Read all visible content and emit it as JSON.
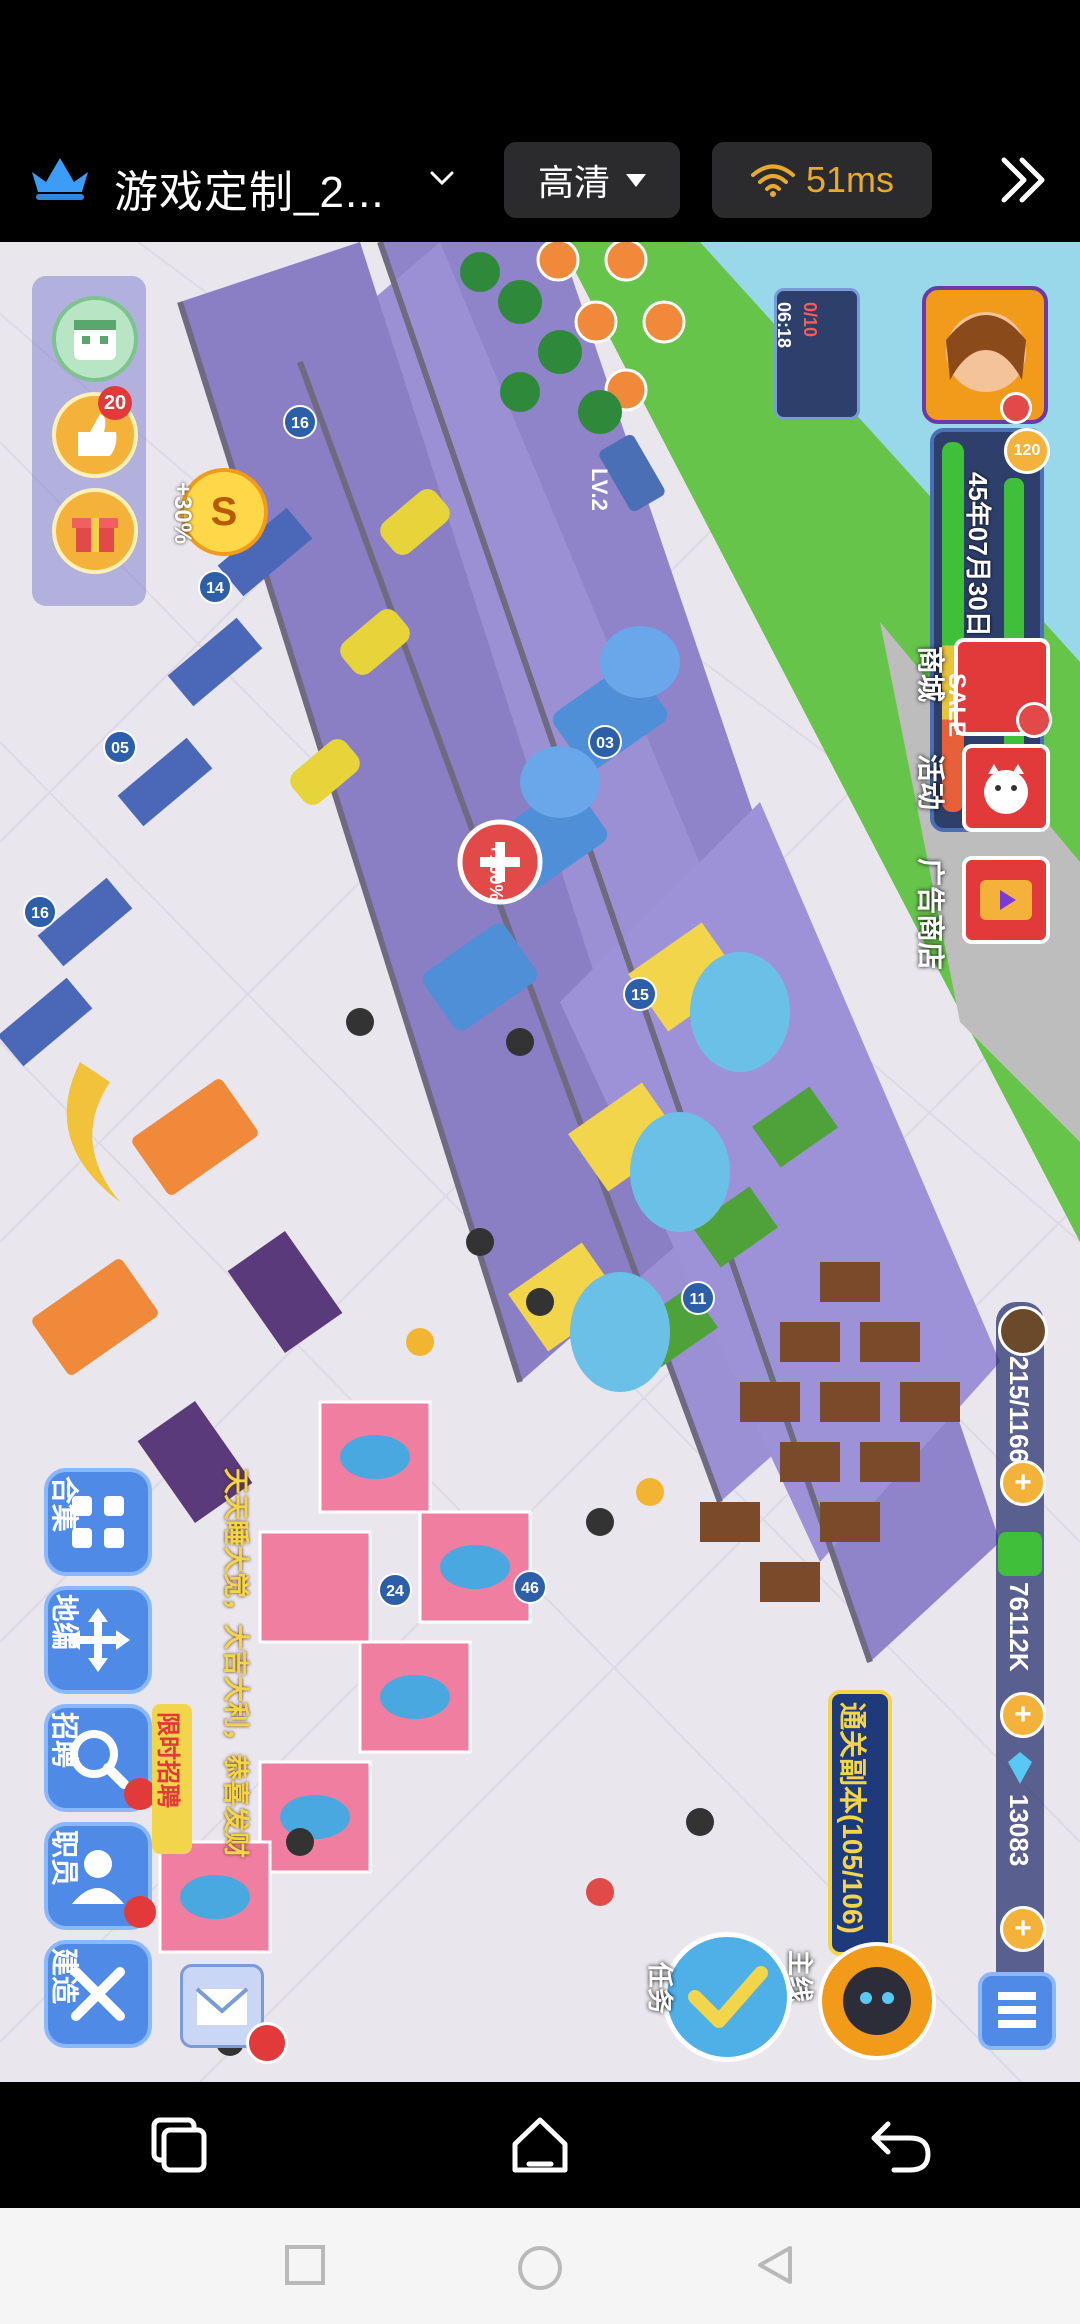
{
  "stream_bar": {
    "title": "游戏定制_2...",
    "quality_label": "高清",
    "ping": "51ms"
  },
  "hud": {
    "badge_count": "20",
    "bonus_percent": "+30%",
    "player_level": "120",
    "game_date": "45年07月30日",
    "timer_count": "0/10",
    "timer_time": "06:18",
    "level_tag": "LV.2",
    "shop_label": "商城",
    "sale_label": "SALE",
    "event_label": "活动",
    "ad_shop_label": "广告商店",
    "population": "215/1166",
    "money": "7611​2K",
    "gems": "13083",
    "main_quest_label": "主线",
    "dungeon_label": "通关副本(105/106)",
    "task_label": "任务",
    "collection_label": "合集",
    "map_edit_label": "地编",
    "recruit_label": "招聘",
    "limited_recruit_label": "限时招聘",
    "staff_label": "职员",
    "build_label": "建造",
    "banner_text": "天天睡大觉，大吉大利，恭喜发财",
    "heal_bonus": "+100%",
    "floor_numbers": [
      "16",
      "14",
      "05",
      "03",
      "15",
      "16",
      "11",
      "24",
      "46"
    ]
  },
  "colors": {
    "floor": "#e9e6ee",
    "purple_zone": "#8f83c9",
    "grass": "#5fbf3e",
    "hud_blue": "#4f8be6",
    "gold": "#f2b531",
    "ping_text": "#e8a92f"
  }
}
